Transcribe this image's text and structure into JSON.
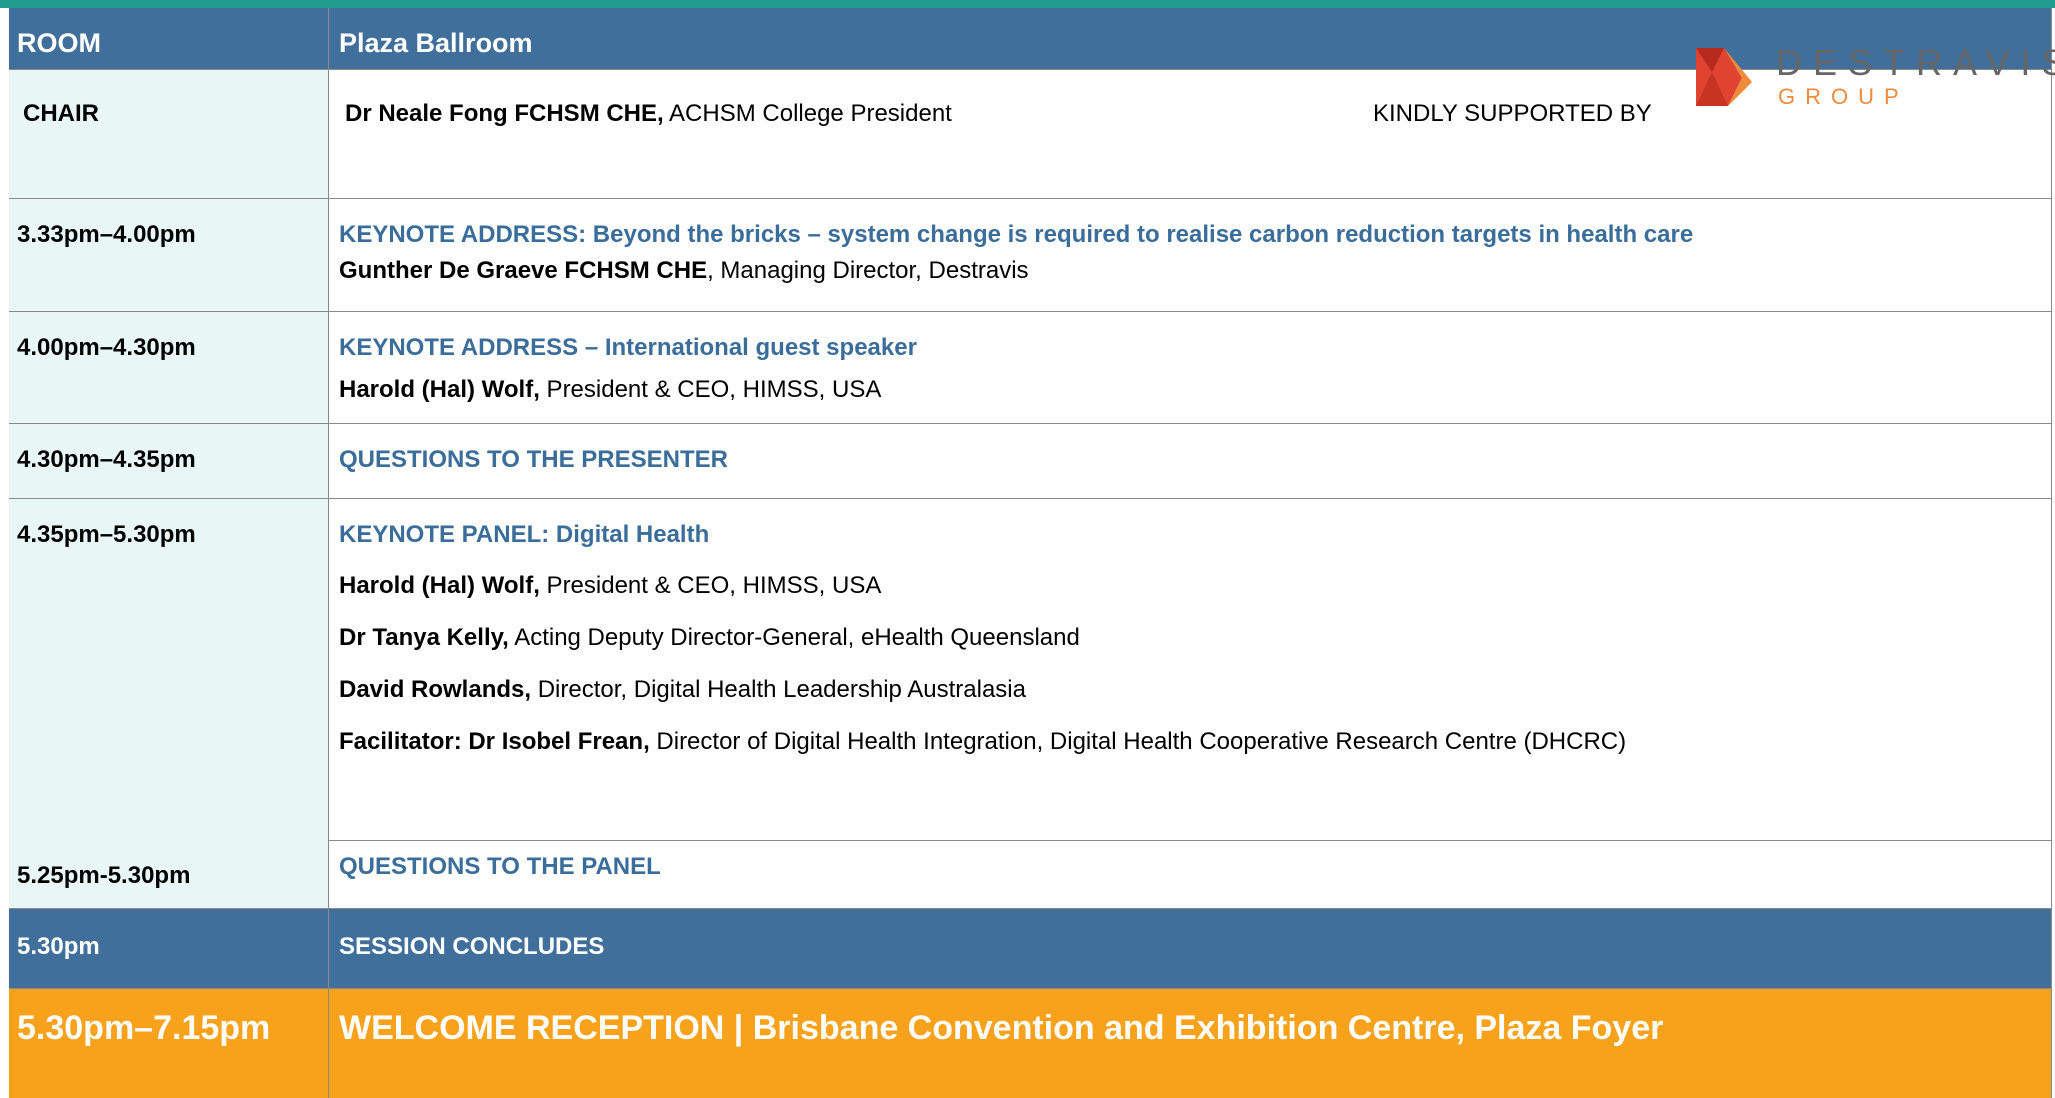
{
  "room": {
    "label": "ROOM",
    "value": "Plaza Ballroom"
  },
  "chair": {
    "label": "CHAIR",
    "name": "Dr Neale Fong FCHSM CHE,",
    "role": " ACHSM College President",
    "supported_by": "KINDLY SUPPORTED BY",
    "logo_text_top": "DESTRAVIS",
    "logo_text_bottom": "GROUP"
  },
  "sessions": [
    {
      "time": "3.33pm–4.00pm",
      "title": "KEYNOTE ADDRESS: Beyond the bricks – system change is required to realise carbon reduction targets in health care",
      "speakers": [
        {
          "name": "Gunther De Graeve FCHSM CHE",
          "role": ", Managing Director, Destravis"
        }
      ]
    },
    {
      "time": "4.00pm–4.30pm",
      "title": "KEYNOTE ADDRESS – International guest speaker",
      "speakers": [
        {
          "name": "Harold (Hal) Wolf,",
          "role": " President & CEO, HIMSS, USA"
        }
      ]
    },
    {
      "time": "4.30pm–4.35pm",
      "title": "QUESTIONS TO THE PRESENTER",
      "speakers": []
    },
    {
      "time": "4.35pm–5.30pm",
      "title": "KEYNOTE PANEL: Digital Health",
      "speakers": [
        {
          "name": "Harold (Hal) Wolf,",
          "role": " President & CEO, HIMSS, USA"
        },
        {
          "name": "Dr Tanya Kelly,",
          "role": " Acting Deputy Director-General, eHealth Queensland"
        },
        {
          "name": "David Rowlands,",
          "role": " Director, Digital Health Leadership Australasia"
        },
        {
          "name": "Facilitator: Dr Isobel Frean,",
          "role": " Director of Digital Health Integration, Digital Health Cooperative Research Centre (DHCRC)"
        }
      ]
    },
    {
      "time": "5.25pm-5.30pm",
      "title": "QUESTIONS TO THE PANEL",
      "speakers": []
    }
  ],
  "conclude": {
    "time": "5.30pm",
    "label": "SESSION CONCLUDES"
  },
  "reception": {
    "time": "5.30pm–7.15pm",
    "label": "WELCOME RECEPTION | Brisbane Convention and Exhibition Centre, Plaza Foyer"
  },
  "colors": {
    "header": "#416f9c",
    "title": "#3a6d9a",
    "accent_orange": "#f8a21b",
    "time_bg": "#e8f7f6",
    "logo_red": "#e0432f",
    "logo_orange": "#f08a3b"
  }
}
